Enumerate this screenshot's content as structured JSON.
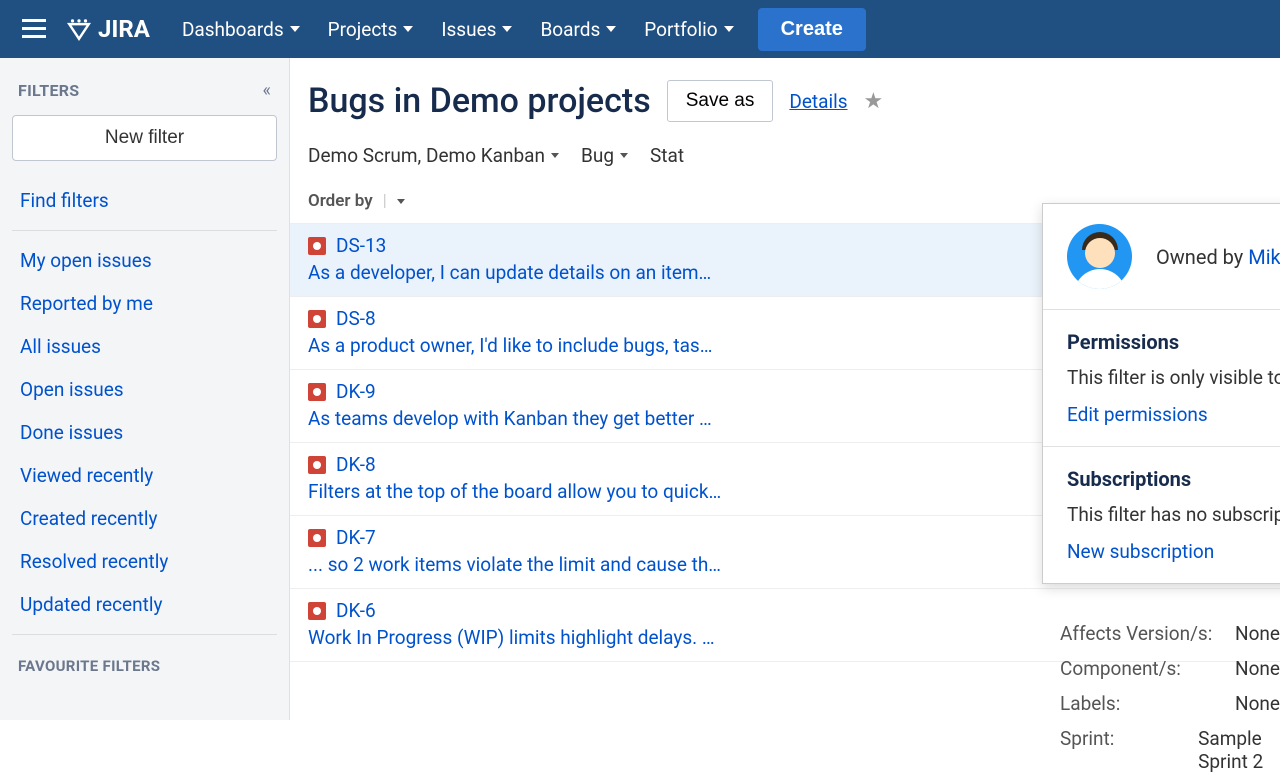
{
  "nav": {
    "dashboards": "Dashboards",
    "projects": "Projects",
    "issues": "Issues",
    "boards": "Boards",
    "portfolio": "Portfolio",
    "create": "Create"
  },
  "sidebar": {
    "title": "FILTERS",
    "new_filter": "New filter",
    "find_filters": "Find filters",
    "links": [
      "My open issues",
      "Reported by me",
      "All issues",
      "Open issues",
      "Done issues",
      "Viewed recently",
      "Created recently",
      "Resolved recently",
      "Updated recently"
    ],
    "fav_title": "FAVOURITE FILTERS"
  },
  "page": {
    "title": "Bugs in Demo projects",
    "save_as": "Save as",
    "details": "Details"
  },
  "filters": {
    "project": "Demo Scrum, Demo Kanban",
    "type": "Bug",
    "status": "Stat"
  },
  "orderby": "Order by",
  "issues": [
    {
      "key": "DS-13",
      "summary": "As a developer, I can update details on an item…"
    },
    {
      "key": "DS-8",
      "summary": "As a product owner, I'd like to include bugs, tas…"
    },
    {
      "key": "DK-9",
      "summary": "As teams develop with Kanban they get better …"
    },
    {
      "key": "DK-8",
      "summary": "Filters at the top of the board allow you to quick…"
    },
    {
      "key": "DK-7",
      "summary": "... so 2 work items violate the limit and cause th…"
    },
    {
      "key": "DK-6",
      "summary": "Work In Progress (WIP) limits highlight delays. …"
    }
  ],
  "popover": {
    "owned_by": "Owned by ",
    "owner": "Mike",
    "perm_title": "Permissions",
    "perm_body": "This filter is only visible to you.",
    "edit_perm": "Edit permissions",
    "subs_title": "Subscriptions",
    "subs_body": "This filter has no subscriptions.",
    "new_sub": "New subscription"
  },
  "detail_fields": [
    {
      "label": "Affects Version/s:",
      "value": "None"
    },
    {
      "label": "Component/s:",
      "value": "None"
    },
    {
      "label": "Labels:",
      "value": "None"
    },
    {
      "label": "Sprint:",
      "value": "Sample Sprint 2"
    }
  ]
}
